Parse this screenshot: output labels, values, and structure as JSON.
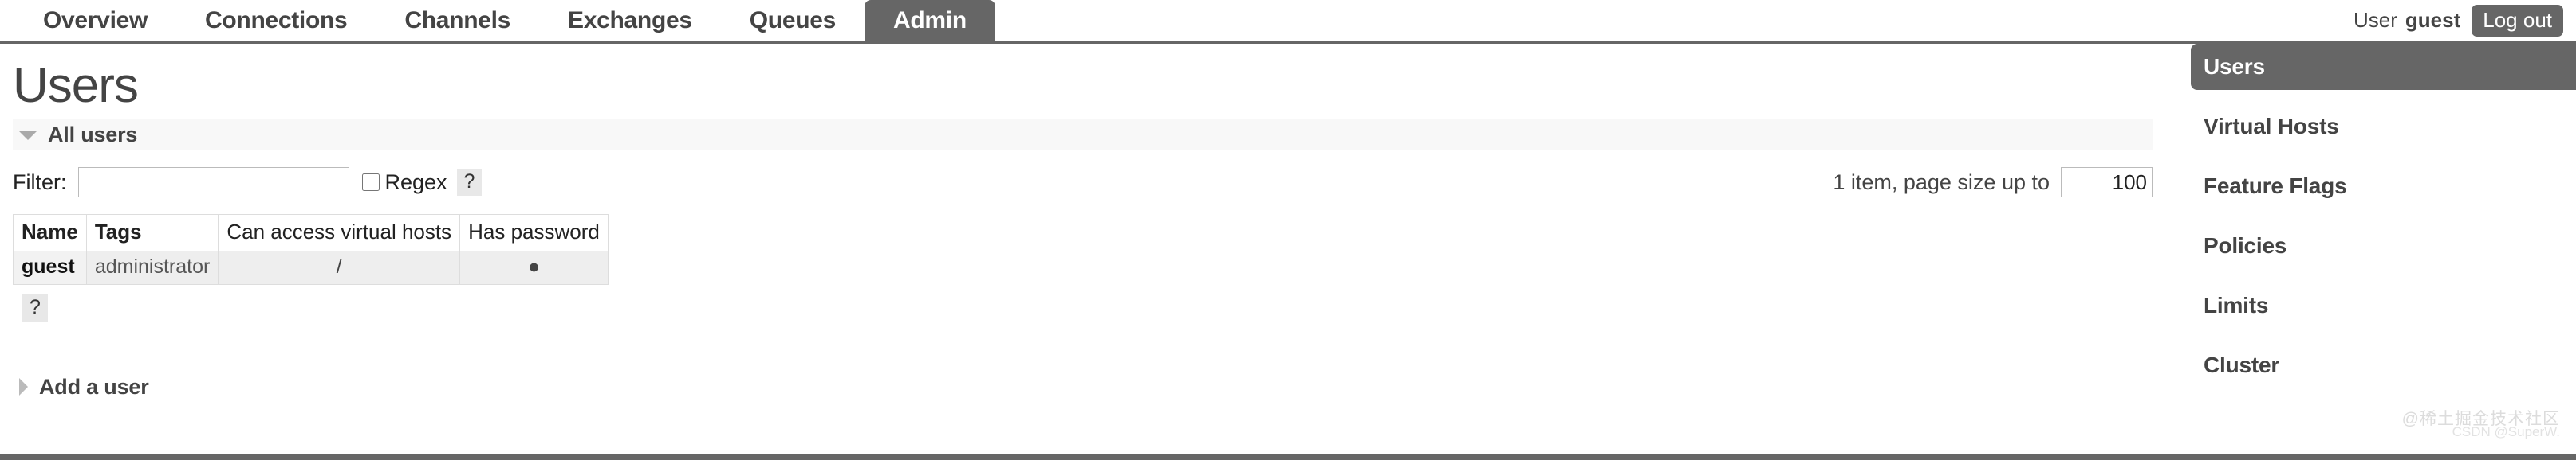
{
  "nav": {
    "tabs": [
      {
        "label": "Overview",
        "active": false
      },
      {
        "label": "Connections",
        "active": false
      },
      {
        "label": "Channels",
        "active": false
      },
      {
        "label": "Exchanges",
        "active": false
      },
      {
        "label": "Queues",
        "active": false
      },
      {
        "label": "Admin",
        "active": true
      }
    ]
  },
  "user": {
    "label": "User",
    "name": "guest",
    "logout_label": "Log out"
  },
  "page": {
    "title": "Users"
  },
  "all_users_section": {
    "title": "All users",
    "expanded": true,
    "triangle": "triangle-down-icon"
  },
  "filter": {
    "label": "Filter:",
    "value": "",
    "placeholder": "",
    "regex_label": "Regex",
    "regex_checked": false,
    "help_label": "?"
  },
  "paging": {
    "summary": "1 item, page size up to",
    "page_size": "100"
  },
  "table": {
    "columns": [
      "Name",
      "Tags",
      "Can access virtual hosts",
      "Has password"
    ],
    "rows": [
      {
        "name": "guest",
        "tags": "administrator",
        "vhosts": "/",
        "has_password": "●"
      }
    ],
    "help_label": "?"
  },
  "add_user_section": {
    "title": "Add a user",
    "expanded": false,
    "triangle": "triangle-right-icon"
  },
  "sidebar": {
    "items": [
      {
        "label": "Users",
        "active": true
      },
      {
        "label": "Virtual Hosts",
        "active": false
      },
      {
        "label": "Feature Flags",
        "active": false
      },
      {
        "label": "Policies",
        "active": false
      },
      {
        "label": "Limits",
        "active": false
      },
      {
        "label": "Cluster",
        "active": false
      }
    ]
  },
  "watermark": {
    "main": "@稀土掘金技术社区",
    "sub": "CSDN @SuperW."
  },
  "colors": {
    "accent": "#666666",
    "text": "#444444",
    "border": "#dddddd",
    "row_bg": "#eeeeee",
    "section_bg": "#f8f8f8"
  }
}
